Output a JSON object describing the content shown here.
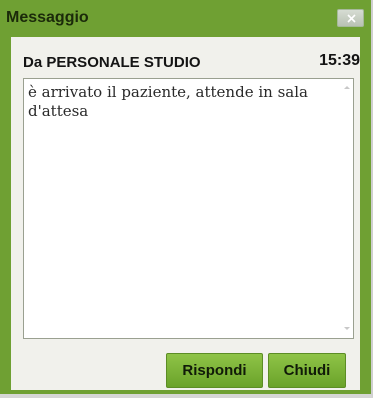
{
  "window": {
    "title": "Messaggio"
  },
  "message": {
    "sender": "Da PERSONALE STUDIO",
    "time": "15:39",
    "text": "è arrivato il paziente, attende in sala d'attesa"
  },
  "buttons": {
    "reply_label": "Rispondi",
    "close_label": "Chiudi"
  },
  "icons": {
    "titlebar_close": "close-icon"
  },
  "colors": {
    "accent": "#6fa033",
    "button": "#7cb63a"
  }
}
